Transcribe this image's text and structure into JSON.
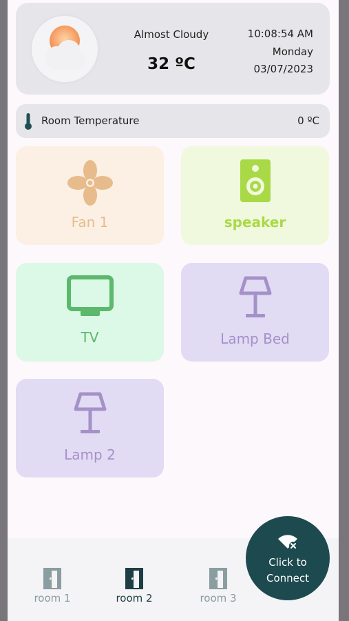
{
  "weather": {
    "condition": "Almost Cloudy",
    "temperature": "32 ºC",
    "time": "10:08:54 AM",
    "day": "Monday",
    "date": "03/07/2023",
    "icon": "sun-behind-cloud-icon"
  },
  "room_temperature": {
    "label": "Room Temperature",
    "value": "0 ºC",
    "icon": "thermometer-icon"
  },
  "devices": [
    {
      "label": "Fan 1",
      "icon": "fan-icon",
      "bg": "#fbf0e3",
      "color": "#e8bb8c"
    },
    {
      "label": "speaker",
      "icon": "speaker-icon",
      "bg": "#f0f9dd",
      "color": "#a9d947"
    },
    {
      "label": "TV",
      "icon": "tv-icon",
      "bg": "#dcf8e6",
      "color": "#5bb86c"
    },
    {
      "label": "Lamp Bed",
      "icon": "lamp-icon",
      "bg": "#e2dbf4",
      "color": "#a591c8"
    },
    {
      "label": "Lamp 2",
      "icon": "lamp-icon",
      "bg": "#e2dbf4",
      "color": "#a591c8"
    }
  ],
  "nav": [
    {
      "label": "room 1",
      "icon": "door-icon",
      "active": false
    },
    {
      "label": "room 2",
      "icon": "door-icon",
      "active": true
    },
    {
      "label": "room 3",
      "icon": "door-icon",
      "active": false
    }
  ],
  "connect": {
    "line1": "Click to",
    "line2": "Connect",
    "icon": "wifi-off-icon"
  },
  "colors": {
    "card_bg": "#e6e5e9",
    "fab_bg": "#1d4a4f",
    "nav_active": "#1d3f43",
    "nav_inactive": "#8a9da0"
  }
}
